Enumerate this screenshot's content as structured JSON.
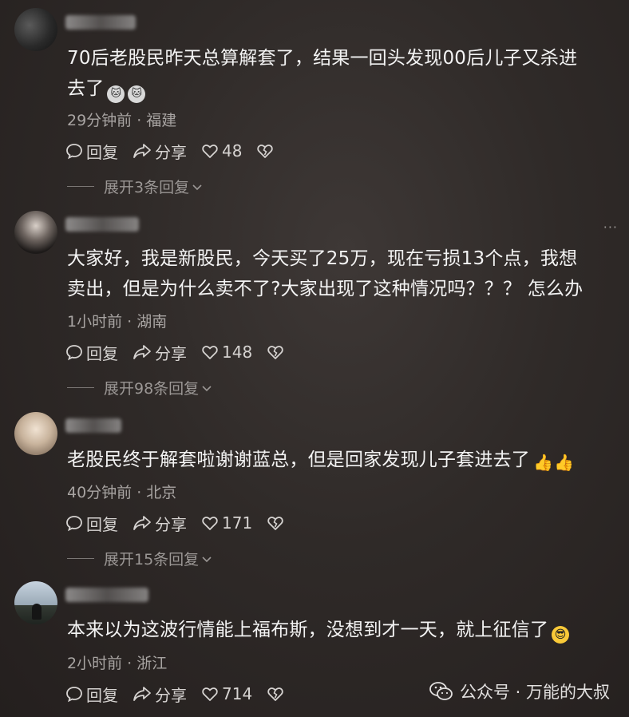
{
  "comments": [
    {
      "text_line1": "70后老股民昨天总算解套了，结果一回头发现00后儿子又杀进",
      "text_line2": "去了",
      "time_location": "29分钟前 · 福建",
      "reply_label": "回复",
      "share_label": "分享",
      "likes": "48",
      "expand": "展开3条回复",
      "emojis": [
        "cat-emoji",
        "cat-emoji"
      ]
    },
    {
      "text_line1": "大家好，我是新股民，今天买了25万，现在亏损13个点，我想",
      "text_line2": "卖出，但是为什么卖不了?大家出现了这种情况吗？？？ 怎么办",
      "time_location": "1小时前 · 湖南",
      "reply_label": "回复",
      "share_label": "分享",
      "likes": "148",
      "expand": "展开98条回复"
    },
    {
      "text_line1": "老股民终于解套啦谢谢蓝总，但是回家发现儿子套进去了",
      "time_location": "40分钟前 · 北京",
      "reply_label": "回复",
      "share_label": "分享",
      "likes": "171",
      "expand": "展开15条回复",
      "emojis": [
        "thumbs-up-emoji",
        "thumbs-up-emoji"
      ]
    },
    {
      "text_line1": "本来以为这波行情能上福布斯，没想到才一天，就上征信了",
      "time_location": "2小时前 · 浙江",
      "reply_label": "回复",
      "share_label": "分享",
      "likes": "714",
      "emojis": [
        "sunglasses-emoji"
      ]
    }
  ],
  "watermark": {
    "text": "公众号 · 万能的大叔",
    "icon": "wechat-icon"
  },
  "colors": {
    "background": "#2f2a28",
    "text": "#f3f3f3",
    "meta": "#a8a4a2"
  }
}
